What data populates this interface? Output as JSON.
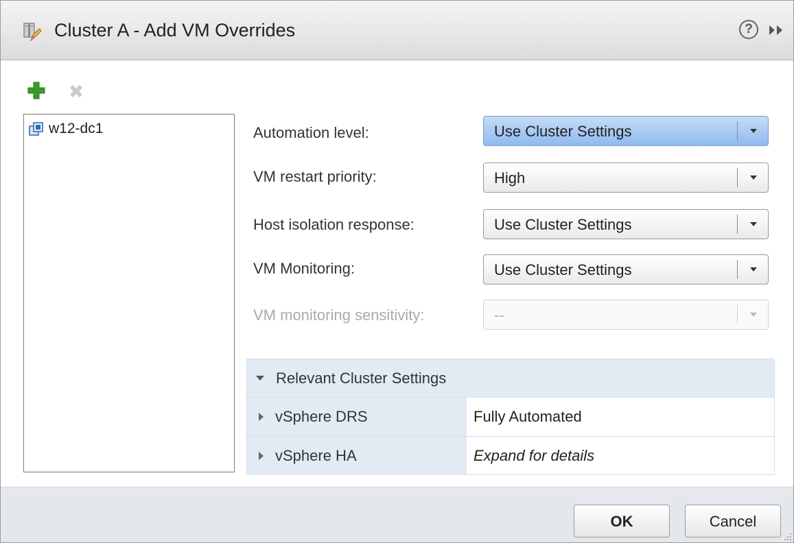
{
  "dialog": {
    "title": "Cluster A - Add VM Overrides",
    "icons": {
      "title": "cluster-edit-icon",
      "help": "help-icon",
      "collapse": "double-chevron-right-icon"
    },
    "help_glyph": "?"
  },
  "toolbar": {
    "add_icon": "add-icon",
    "remove_icon": "remove-icon",
    "accent_add": "#3a9a2a",
    "accent_remove": "#c4c4c4"
  },
  "vm_list": {
    "items": [
      {
        "label": "w12-dc1",
        "icon": "vm-icon"
      }
    ]
  },
  "settings": {
    "fields": [
      {
        "label": "Automation level:",
        "value": "Use Cluster Settings",
        "state": "active"
      },
      {
        "label": "VM restart priority:",
        "value": "High",
        "state": "normal"
      },
      {
        "label": "Host isolation response:",
        "value": "Use Cluster Settings",
        "state": "normal"
      },
      {
        "label": "VM Monitoring:",
        "value": "Use Cluster Settings",
        "state": "normal"
      },
      {
        "label": "VM monitoring sensitivity:",
        "value": "--",
        "state": "disabled"
      }
    ]
  },
  "relevant_cluster_settings": {
    "title": "Relevant Cluster Settings",
    "rows": [
      {
        "name": "vSphere DRS",
        "value": "Fully Automated"
      },
      {
        "name": "vSphere HA",
        "value": "Expand for details"
      }
    ]
  },
  "footer": {
    "ok_label": "OK",
    "cancel_label": "Cancel"
  }
}
